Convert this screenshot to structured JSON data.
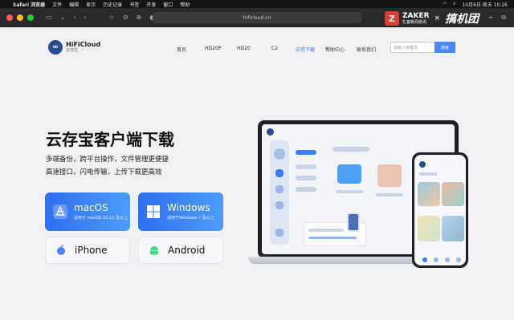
{
  "menubar": {
    "items": [
      "Safari 浏览器",
      "文件",
      "编辑",
      "显示",
      "历史记录",
      "书签",
      "开发",
      "窗口",
      "帮助"
    ],
    "datetime": "10月6日 周五 10:26"
  },
  "browser": {
    "url": "hificloud.cn"
  },
  "watermark": {
    "brand": "ZAKER",
    "tagline": "扎客新闻资讯",
    "times": "×",
    "partner": "搞机团"
  },
  "site": {
    "logo_name": "HiFiCloud",
    "logo_sub": "云存宝",
    "nav": [
      "首页",
      "HD20P",
      "HD20",
      "C2",
      "应用下载",
      "帮助中心",
      "联系我们"
    ],
    "search_placeholder": "请输入关键词",
    "search_button": "搜索"
  },
  "hero": {
    "title": "云存宝客户端下载",
    "line1": "多端备份，跨平台操作，文件管理更便捷",
    "line2": "高速接口，闪电传输，上传下载更高效"
  },
  "downloads": {
    "macos": {
      "label": "macOS",
      "note": "适用于 macOS 10.13 及以上"
    },
    "windows": {
      "label": "Windows",
      "note": "适用于Windows 7 及以上"
    },
    "iphone": {
      "label": "iPhone"
    },
    "android": {
      "label": "Android"
    }
  },
  "colors": {
    "accent": "#3a7bf5",
    "button_blue": "#2f6ef0"
  }
}
